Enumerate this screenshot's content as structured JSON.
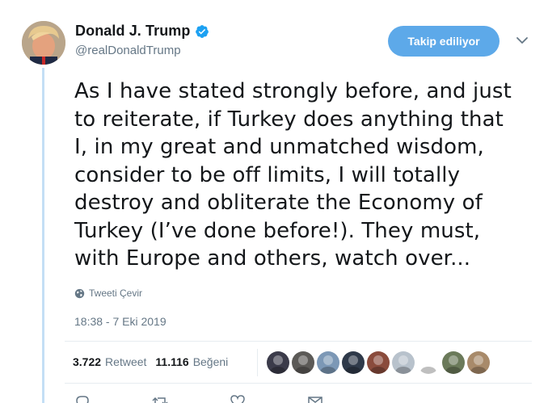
{
  "author": {
    "display_name": "Donald J. Trump",
    "handle": "@realDonaldTrump",
    "verified_icon": "verified-badge-icon",
    "avatar_icon": "profile-avatar"
  },
  "follow_button": {
    "label": "Takip ediliyor"
  },
  "menu_icon": "chevron-down-icon",
  "tweet": {
    "text": "As I have stated strongly before, and just\nto reiterate, if Turkey does anything that\nI, in my great and unmatched wisdom,\nconsider to be off limits, I will totally\ndestroy and obliterate the Economy of\nTurkey (I’ve done before!). They must,\nwith Europe and others, watch over..."
  },
  "translate": {
    "label": "Tweeti Çevir",
    "icon": "globe-icon"
  },
  "timestamp": "18:38 - 7 Eki 2019",
  "stats": {
    "retweets": {
      "count": "3.722",
      "label": "Retweet"
    },
    "likes": {
      "count": "11.116",
      "label": "Beğeni"
    }
  },
  "likers": [
    {
      "name": "liker-avatar-1",
      "color": "#3b3b4a"
    },
    {
      "name": "liker-avatar-2",
      "color": "#5c5a57"
    },
    {
      "name": "liker-avatar-3",
      "color": "#7c98b6"
    },
    {
      "name": "liker-avatar-4",
      "color": "#2f3a4a"
    },
    {
      "name": "liker-avatar-5",
      "color": "#8a4b3c"
    },
    {
      "name": "liker-avatar-6",
      "color": "#b8c2cc"
    },
    {
      "name": "liker-avatar-7",
      "color": "#ffffff"
    },
    {
      "name": "liker-avatar-8",
      "color": "#6b7a5a"
    },
    {
      "name": "liker-avatar-9",
      "color": "#a88a6a"
    }
  ],
  "colors": {
    "accent": "#1da1f2",
    "follow_button_bg": "#5da9e9",
    "muted_text": "#657786",
    "thread_line": "#c4dff5"
  }
}
